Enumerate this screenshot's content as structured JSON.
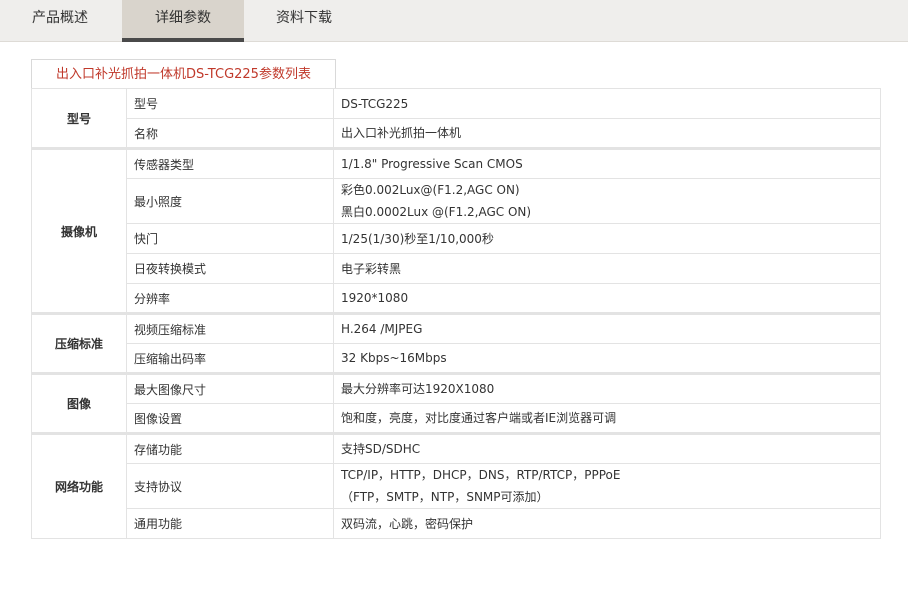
{
  "tabs": [
    {
      "label": "产品概述",
      "active": false
    },
    {
      "label": "详细参数",
      "active": true
    },
    {
      "label": "资料下载",
      "active": false
    }
  ],
  "section_title": "出入口补光抓拍一体机DS-TCG225参数列表",
  "groups": [
    {
      "name": "型号",
      "rows": [
        {
          "name": "型号",
          "value": [
            "DS-TCG225"
          ]
        },
        {
          "name": "名称",
          "value": [
            "出入口补光抓拍一体机"
          ]
        }
      ]
    },
    {
      "name": "摄像机",
      "rows": [
        {
          "name": "传感器类型",
          "value": [
            "1/1.8\" Progressive Scan CMOS"
          ]
        },
        {
          "name": "最小照度",
          "value": [
            "彩色0.002Lux@(F1.2,AGC ON)",
            "黑白0.0002Lux @(F1.2,AGC ON)"
          ]
        },
        {
          "name": "快门",
          "value": [
            "1/25(1/30)秒至1/10,000秒"
          ]
        },
        {
          "name": "日夜转换模式",
          "value": [
            "电子彩转黑"
          ]
        },
        {
          "name": "分辨率",
          "value": [
            "1920*1080"
          ]
        }
      ]
    },
    {
      "name": "压缩标准",
      "rows": [
        {
          "name": "视频压缩标准",
          "value": [
            "H.264 /MJPEG"
          ]
        },
        {
          "name": "压缩输出码率",
          "value": [
            "32 Kbps~16Mbps"
          ]
        }
      ]
    },
    {
      "name": "图像",
      "rows": [
        {
          "name": "最大图像尺寸",
          "value": [
            "最大分辨率可达1920X1080"
          ]
        },
        {
          "name": "图像设置",
          "value": [
            "饱和度，亮度，对比度通过客户端或者IE浏览器可调"
          ]
        }
      ]
    },
    {
      "name": "网络功能",
      "rows": [
        {
          "name": "存储功能",
          "value": [
            "支持SD/SDHC"
          ]
        },
        {
          "name": "支持协议",
          "value": [
            "TCP/IP，HTTP，DHCP，DNS，RTP/RTCP，PPPoE",
            "（FTP，SMTP，NTP，SNMP可添加）"
          ]
        },
        {
          "name": "通用功能",
          "value": [
            "双码流，心跳，密码保护"
          ]
        }
      ]
    }
  ]
}
